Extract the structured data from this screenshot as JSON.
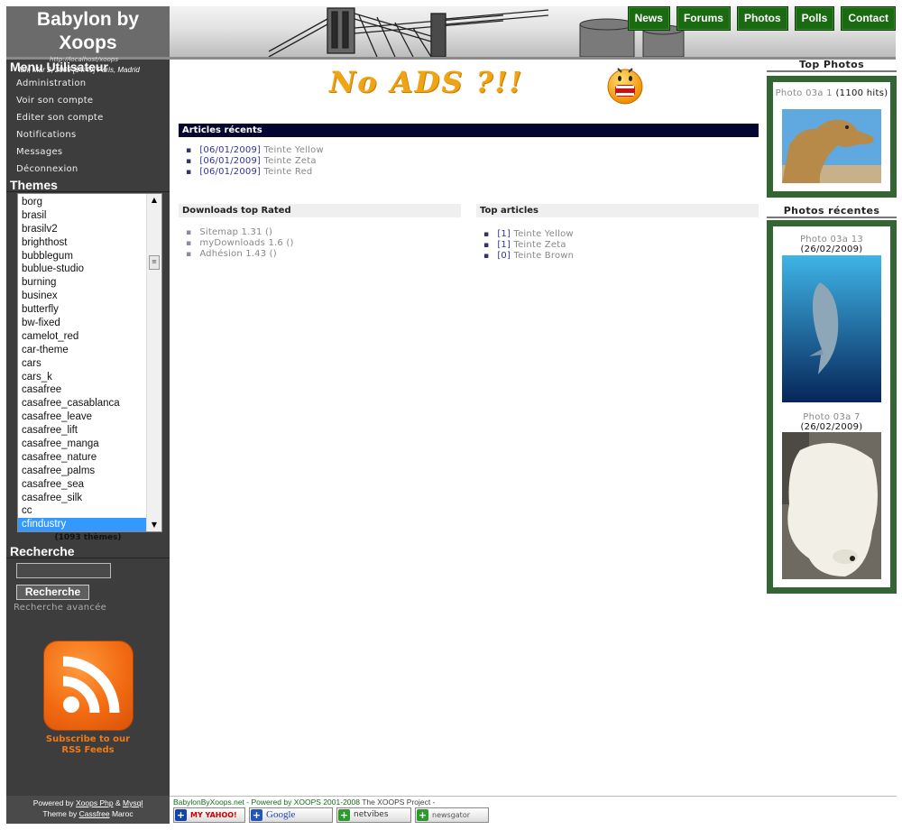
{
  "site": {
    "title": "Babylon by Xoops"
  },
  "nav": [
    "News",
    "Forums",
    "Photos",
    "Polls",
    "Contact"
  ],
  "sidebar": {
    "menu_title": "Menu Utilisateur",
    "date_line": "lun, Mar 2, 2009 [14:49] Paris, Madrid",
    "tiny_line": "http://localhost/xoops",
    "menu": [
      "Administration",
      "Voir son compte",
      "Editer son compte",
      "Notifications",
      "Messages",
      "Déconnexion"
    ],
    "themes_title": "Themes",
    "themes": [
      "borg",
      "brasil",
      "brasilv2",
      "brighthost",
      "bubblegum",
      "bublue-studio",
      "burning",
      "businex",
      "butterfly",
      "bw-fixed",
      "camelot_red",
      "car-theme",
      "cars",
      "cars_k",
      "casafree",
      "casafree_casablanca",
      "casafree_leave",
      "casafree_lift",
      "casafree_manga",
      "casafree_nature",
      "casafree_palms",
      "casafree_sea",
      "casafree_silk",
      "cc",
      "cfindustry"
    ],
    "themes_selected": "cfindustry",
    "themes_count": "(1093 thèmes)",
    "search_title": "Recherche",
    "search_value": "",
    "search_button": "Recherche",
    "advanced_search": "Recherche avancée",
    "rss_line1": "Subscribe to our",
    "rss_line2": "RSS Feeds",
    "footer_line1_prefix": "Powered by",
    "footer_link1": "Xoops Php",
    "footer_amp": "&",
    "footer_link2": "Mysql",
    "footer_line2_prefix": "Theme by",
    "footer_link3": "Cassfree",
    "footer_line2_suffix": "Maroc"
  },
  "center": {
    "banner_text": "No ADS ?!!",
    "recent_title": "Articles récents",
    "recent": [
      {
        "date": "[06/01/2009]",
        "title": "Teinte Yellow"
      },
      {
        "date": "[06/01/2009]",
        "title": "Teinte Zeta"
      },
      {
        "date": "[06/01/2009]",
        "title": "Teinte Red"
      }
    ],
    "downloads_title": "Downloads top Rated",
    "downloads": [
      "Sitemap 1.31 ()",
      "myDownloads 1.6 ()",
      "Adhésion 1.43 ()"
    ],
    "top_title": "Top articles",
    "top": [
      {
        "count": "[1]",
        "title": "Teinte Yellow"
      },
      {
        "count": "[1]",
        "title": "Teinte Zeta"
      },
      {
        "count": "[0]",
        "title": "Teinte Brown"
      }
    ]
  },
  "right": {
    "top_photos_title": "Top Photos",
    "top_photo": {
      "name": "Photo 03a 1",
      "info": "(1100 hits)"
    },
    "recent_title": "Photos récentes",
    "recent_photos": [
      {
        "name": "Photo 03a 13",
        "info": "(26/02/2009)"
      },
      {
        "name": "Photo 03a 7",
        "info": "(26/02/2009)"
      }
    ]
  },
  "footer": {
    "site": "BabylonByXoops.net",
    "sep": " - ",
    "powered": "Powered by XOOPS 2001-2008",
    "project": "The XOOPS Project",
    "tail": " -",
    "feeds": [
      "MY YAHOO!",
      "Google",
      "netvibes",
      "newsgator"
    ]
  },
  "colors": {
    "nav_green": "#1a6a12",
    "box_green": "#336633",
    "recent_header": "#050531",
    "sidebar": "#3d3d3d",
    "rss_orange": "#f26b12"
  }
}
